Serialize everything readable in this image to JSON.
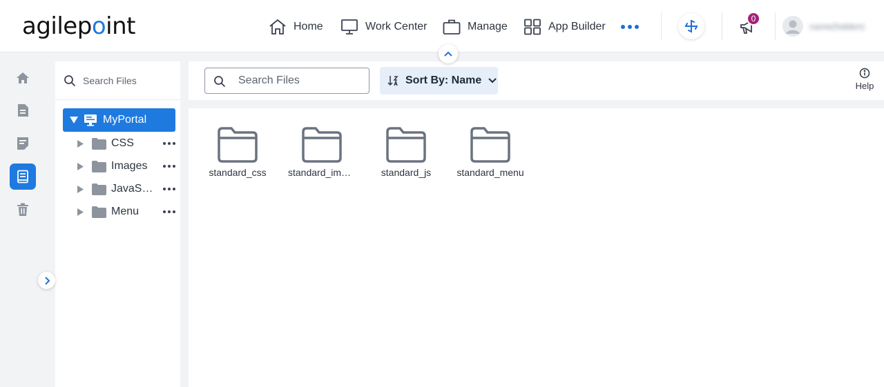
{
  "header": {
    "logo": {
      "before": "agilep",
      "mark": "o",
      "after": "int"
    },
    "nav": [
      {
        "label": "Home",
        "icon": "home-icon"
      },
      {
        "label": "Work Center",
        "icon": "monitor-icon"
      },
      {
        "label": "Manage",
        "icon": "briefcase-icon"
      },
      {
        "label": "App Builder",
        "icon": "grid-icon"
      }
    ],
    "more_icon": "more-horizontal-icon",
    "notification_count": "0",
    "user_name": "name(hidden)"
  },
  "rail": {
    "items": [
      {
        "name": "home",
        "icon": "home-icon",
        "active": false
      },
      {
        "name": "documents",
        "icon": "document-icon",
        "active": false
      },
      {
        "name": "forms",
        "icon": "form-icon",
        "active": false
      },
      {
        "name": "files",
        "icon": "book-icon",
        "active": true
      },
      {
        "name": "trash",
        "icon": "trash-icon",
        "active": false
      }
    ]
  },
  "tree": {
    "search_placeholder": "Search Files",
    "root": {
      "label": "MyPortal"
    },
    "children": [
      {
        "label": "CSS"
      },
      {
        "label": "Images"
      },
      {
        "label": "JavaScript"
      },
      {
        "label": "Menu"
      }
    ]
  },
  "toolbar": {
    "search_placeholder": "Search Files",
    "sort_label": "Sort By: Name",
    "help_label": "Help"
  },
  "content": {
    "folders": [
      {
        "name": "standard_css"
      },
      {
        "name": "standard_images"
      },
      {
        "name": "standard_js"
      },
      {
        "name": "standard_menu"
      }
    ]
  },
  "colors": {
    "accent": "#1f7ae0",
    "badge": "#a61f7a",
    "sort_bg": "#e5eef9",
    "folder_stroke": "#6b7280"
  }
}
